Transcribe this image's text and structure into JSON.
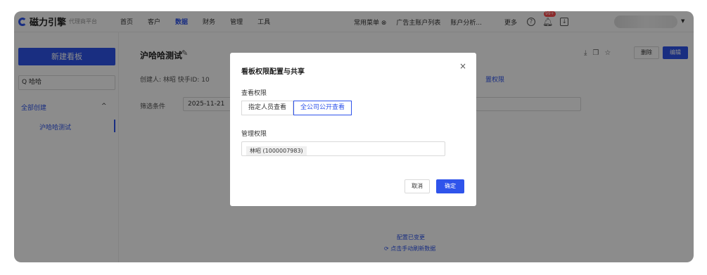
{
  "app": {
    "logo_text": "磁力引擎",
    "logo_sub": "代理商平台"
  },
  "nav": {
    "left": [
      "首页",
      "客户",
      "数据",
      "财务",
      "管理",
      "工具"
    ],
    "active_index": 2,
    "right": [
      "常用菜单 ⊗",
      "广告主账户列表",
      "账户分析...",
      "更多"
    ],
    "badge": "99+"
  },
  "sidebar": {
    "new_button": "新建看板",
    "search_value": "Q 哈哈",
    "group_label": "全部创建",
    "group_caret": "^",
    "item": "沪哈哈测试"
  },
  "main": {
    "title": "沪哈哈测试",
    "meta": "创建人: 林昭    快手ID: 10",
    "filter_label": "筛选条件",
    "date": "2025-11-21",
    "perm_link": "置权限",
    "delete_label": "删除",
    "edit_label": "编辑",
    "changed": "配置已变更",
    "refresh": "⟳ 点击手动刷新数据"
  },
  "modal": {
    "title": "看板权限配置与共享",
    "close": "×",
    "view_label": "查看权限",
    "view_options": [
      "指定人员查看",
      "全公司公开查看"
    ],
    "view_selected": 1,
    "manage_label": "管理权限",
    "manage_tag": "林昭 (1000007983)",
    "cancel": "取消",
    "ok": "确定"
  },
  "colors": {
    "accent": "#2f54eb",
    "danger": "#ff4d4f"
  }
}
